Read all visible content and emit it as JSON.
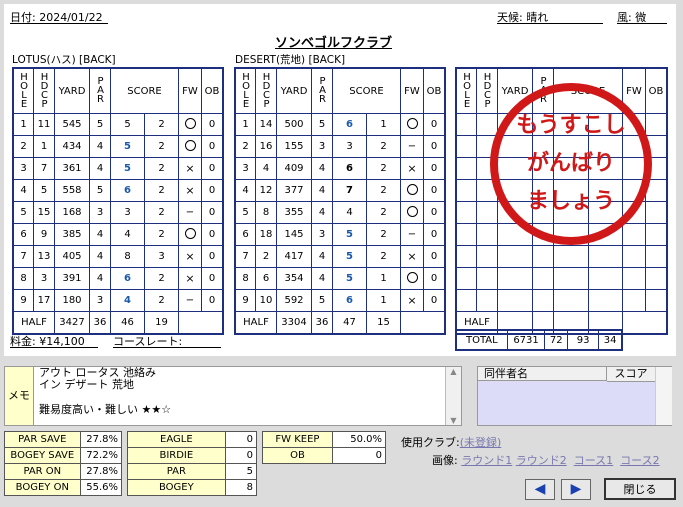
{
  "header": {
    "date": "日付: 2024/01/22",
    "title": "ソンベゴルフクラブ",
    "weather": "天候: 晴れ",
    "wind": "風: 微"
  },
  "course1": {
    "name": "LOTUS(ハス) [BACK]"
  },
  "course2": {
    "name": "DESERT(荒地) [BACK]"
  },
  "columns": {
    "hole": "HOLE",
    "hdcp": "HDCP",
    "yard": "YARD",
    "par": "PAR",
    "score": "SCORE",
    "fw": "FW",
    "ob": "OB"
  },
  "rows1": [
    {
      "hole": "1",
      "hdcp": "11",
      "yard": "545",
      "par": "5",
      "s": "5",
      "p": "2",
      "fw": "o",
      "ob": "0",
      "c": ""
    },
    {
      "hole": "2",
      "hdcp": "1",
      "yard": "434",
      "par": "4",
      "s": "5",
      "p": "2",
      "fw": "o",
      "ob": "0",
      "c": "blue"
    },
    {
      "hole": "3",
      "hdcp": "7",
      "yard": "361",
      "par": "4",
      "s": "5",
      "p": "2",
      "fw": "x",
      "ob": "0",
      "c": "blue"
    },
    {
      "hole": "4",
      "hdcp": "5",
      "yard": "558",
      "par": "5",
      "s": "6",
      "p": "2",
      "fw": "x",
      "ob": "0",
      "c": "blue"
    },
    {
      "hole": "5",
      "hdcp": "15",
      "yard": "168",
      "par": "3",
      "s": "3",
      "p": "2",
      "fw": "-",
      "ob": "0",
      "c": ""
    },
    {
      "hole": "6",
      "hdcp": "9",
      "yard": "385",
      "par": "4",
      "s": "4",
      "p": "2",
      "fw": "o",
      "ob": "0",
      "c": ""
    },
    {
      "hole": "7",
      "hdcp": "13",
      "yard": "405",
      "par": "4",
      "s": "8",
      "p": "3",
      "fw": "x",
      "ob": "0",
      "c": ""
    },
    {
      "hole": "8",
      "hdcp": "3",
      "yard": "391",
      "par": "4",
      "s": "6",
      "p": "2",
      "fw": "x",
      "ob": "0",
      "c": "blue"
    },
    {
      "hole": "9",
      "hdcp": "17",
      "yard": "180",
      "par": "3",
      "s": "4",
      "p": "2",
      "fw": "-",
      "ob": "0",
      "c": "blue"
    }
  ],
  "half1": {
    "label": "HALF",
    "yard": "3427",
    "par": "36",
    "score": "46",
    "putt": "19"
  },
  "rows2": [
    {
      "hole": "1",
      "hdcp": "14",
      "yard": "500",
      "par": "5",
      "s": "6",
      "p": "1",
      "fw": "o",
      "ob": "0",
      "c": "blue"
    },
    {
      "hole": "2",
      "hdcp": "16",
      "yard": "155",
      "par": "3",
      "s": "3",
      "p": "2",
      "fw": "-",
      "ob": "0",
      "c": ""
    },
    {
      "hole": "3",
      "hdcp": "4",
      "yard": "409",
      "par": "4",
      "s": "6",
      "p": "2",
      "fw": "x",
      "ob": "0",
      "c": "black"
    },
    {
      "hole": "4",
      "hdcp": "12",
      "yard": "377",
      "par": "4",
      "s": "7",
      "p": "2",
      "fw": "o",
      "ob": "0",
      "c": "black"
    },
    {
      "hole": "5",
      "hdcp": "8",
      "yard": "355",
      "par": "4",
      "s": "4",
      "p": "2",
      "fw": "o",
      "ob": "0",
      "c": ""
    },
    {
      "hole": "6",
      "hdcp": "18",
      "yard": "145",
      "par": "3",
      "s": "5",
      "p": "2",
      "fw": "-",
      "ob": "0",
      "c": "blue"
    },
    {
      "hole": "7",
      "hdcp": "2",
      "yard": "417",
      "par": "4",
      "s": "5",
      "p": "2",
      "fw": "x",
      "ob": "0",
      "c": "blue"
    },
    {
      "hole": "8",
      "hdcp": "6",
      "yard": "354",
      "par": "4",
      "s": "5",
      "p": "1",
      "fw": "o",
      "ob": "0",
      "c": "blue"
    },
    {
      "hole": "9",
      "hdcp": "10",
      "yard": "592",
      "par": "5",
      "s": "6",
      "p": "1",
      "fw": "x",
      "ob": "0",
      "c": "blue"
    }
  ],
  "half2": {
    "label": "HALF",
    "yard": "3304",
    "par": "36",
    "score": "47",
    "putt": "15"
  },
  "half3": {
    "label": "HALF"
  },
  "total": {
    "label": "TOTAL",
    "yard": "6731",
    "par": "72",
    "score": "93",
    "putt": "34"
  },
  "stamp": {
    "line1": "もうすこし",
    "line2": "がんばり",
    "line3": "ましょう"
  },
  "fee": {
    "label": "料金:",
    "value": "¥14,100"
  },
  "rate": {
    "label": "コースレート:"
  },
  "memo": {
    "label": "メモ",
    "line1": "アウト ロータス 池絡み",
    "line2": "イン デザート 荒地",
    "line3": "難易度高い・難しい ★★☆"
  },
  "companions": {
    "col1": "同伴者名",
    "col2": "スコア"
  },
  "stats1": [
    {
      "label": "PAR SAVE",
      "value": "27.8%"
    },
    {
      "label": "BOGEY SAVE",
      "value": "72.2%"
    },
    {
      "label": "PAR ON",
      "value": "27.8%"
    },
    {
      "label": "BOGEY ON",
      "value": "55.6%"
    }
  ],
  "stats2": [
    {
      "label": "EAGLE",
      "value": "0"
    },
    {
      "label": "BIRDIE",
      "value": "0"
    },
    {
      "label": "PAR",
      "value": "5"
    },
    {
      "label": "BOGEY",
      "value": "8"
    }
  ],
  "stats3": [
    {
      "label": "FW KEEP",
      "value": "50.0%"
    },
    {
      "label": "OB",
      "value": "0"
    }
  ],
  "clubs": {
    "label": "使用クラブ:",
    "value": "(未登録)"
  },
  "images": {
    "label": "画像:",
    "r1": "ラウンド1",
    "r2": "ラウンド2",
    "c1": "コース1",
    "c2": "コース2"
  },
  "buttons": {
    "prev": "◀",
    "next": "▶",
    "close": "閉じる"
  }
}
